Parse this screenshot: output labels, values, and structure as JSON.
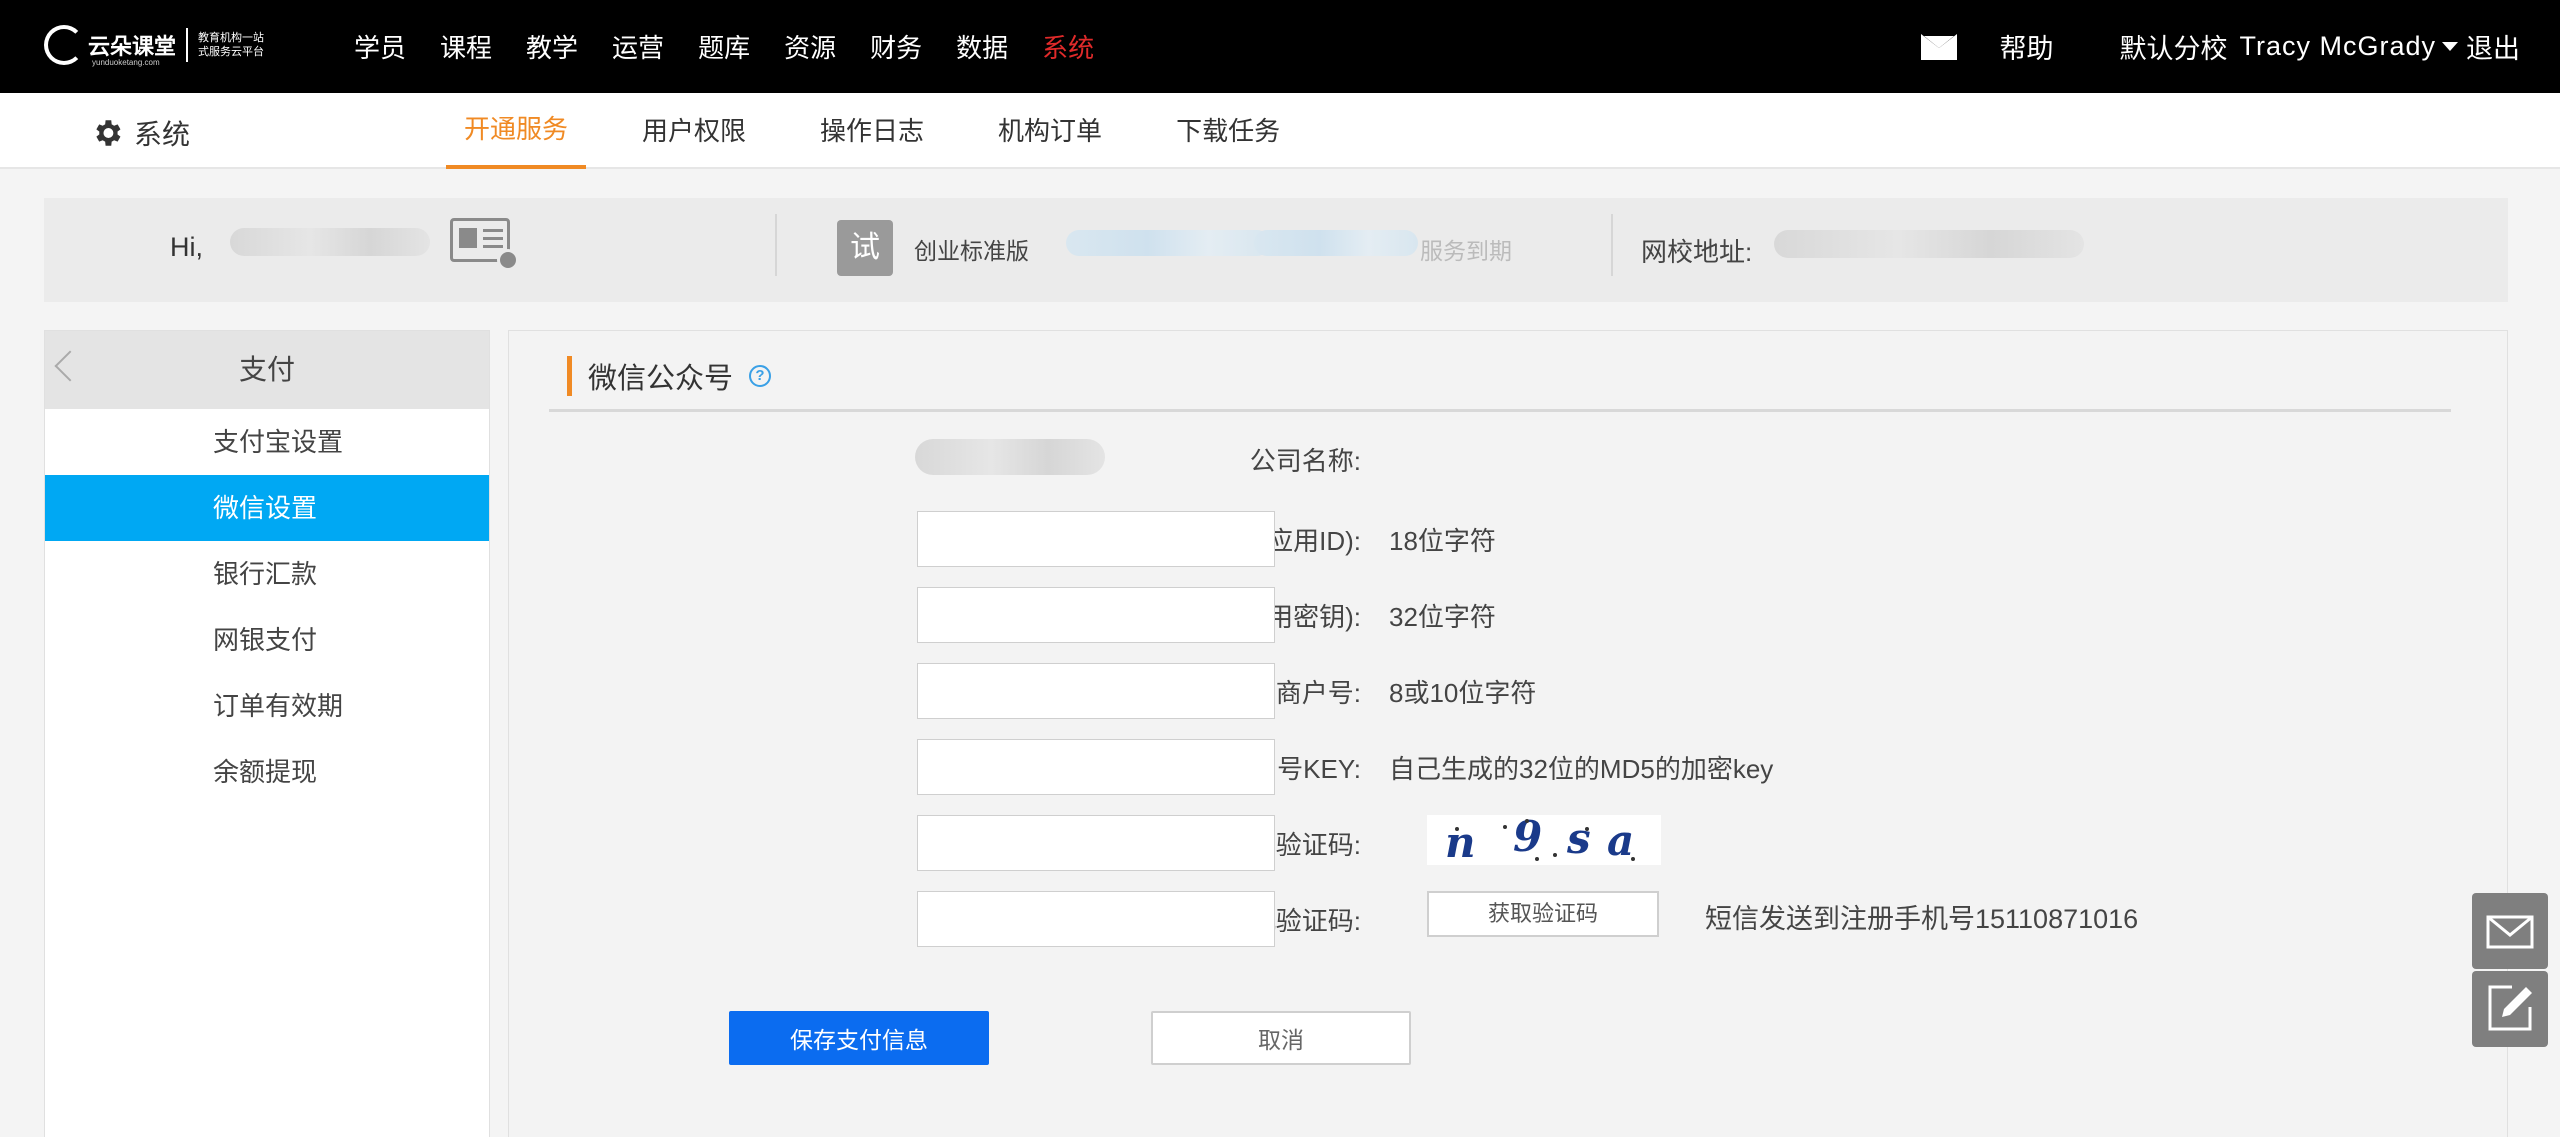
{
  "topbar": {
    "logo_brand": "云朵课堂",
    "logo_slogan_1": "教育机构一站",
    "logo_slogan_2": "式服务云平台",
    "logo_url": "yunduoketang.com",
    "nav": [
      "学员",
      "课程",
      "教学",
      "运营",
      "题库",
      "资源",
      "财务",
      "数据",
      "系统"
    ],
    "active_nav": "系统",
    "help": "帮助",
    "school": "默认分校",
    "user": "Tracy McGrady",
    "logout": "退出"
  },
  "subnav": {
    "title": "系统",
    "tabs": [
      "开通服务",
      "用户权限",
      "操作日志",
      "机构订单",
      "下载任务"
    ],
    "active_tab": "开通服务"
  },
  "infobar": {
    "greeting": "Hi,",
    "trial_badge": "试",
    "plan": "创业标准版",
    "expire_label": "服务到期",
    "school_url_label": "网校地址:"
  },
  "sidebar": {
    "title": "支付",
    "items": [
      "支付宝设置",
      "微信设置",
      "银行汇款",
      "网银支付",
      "订单有效期",
      "余额提现"
    ],
    "active_item": "微信设置"
  },
  "form": {
    "section_title": "微信公众号",
    "help_glyph": "?",
    "company_label": "公司名称:",
    "fields": [
      {
        "label": "AppID(应用ID):",
        "value": "",
        "hint": "18位字符"
      },
      {
        "label": "AppSecret(应用密钥):",
        "value": "",
        "hint": "32位字符"
      },
      {
        "label": "微信支付商户号:",
        "value": "",
        "hint": "8或10位字符"
      },
      {
        "label": "微信支付商户号KEY:",
        "value": "",
        "hint": "自己生成的32位的MD5的加密key"
      },
      {
        "label": "图形验证码:",
        "value": ""
      },
      {
        "label": "手机验证码:",
        "value": ""
      }
    ],
    "captcha_text": "n9sa",
    "get_code_button": "获取验证码",
    "sms_note": "短信发送到注册手机号15110871016",
    "save_button": "保存支付信息",
    "cancel_button": "取消"
  },
  "colors": {
    "accent_orange": "#f08a24",
    "active_blue": "#00a8f3",
    "primary_button": "#0b6cf0",
    "active_top_nav": "#e02a2a"
  }
}
